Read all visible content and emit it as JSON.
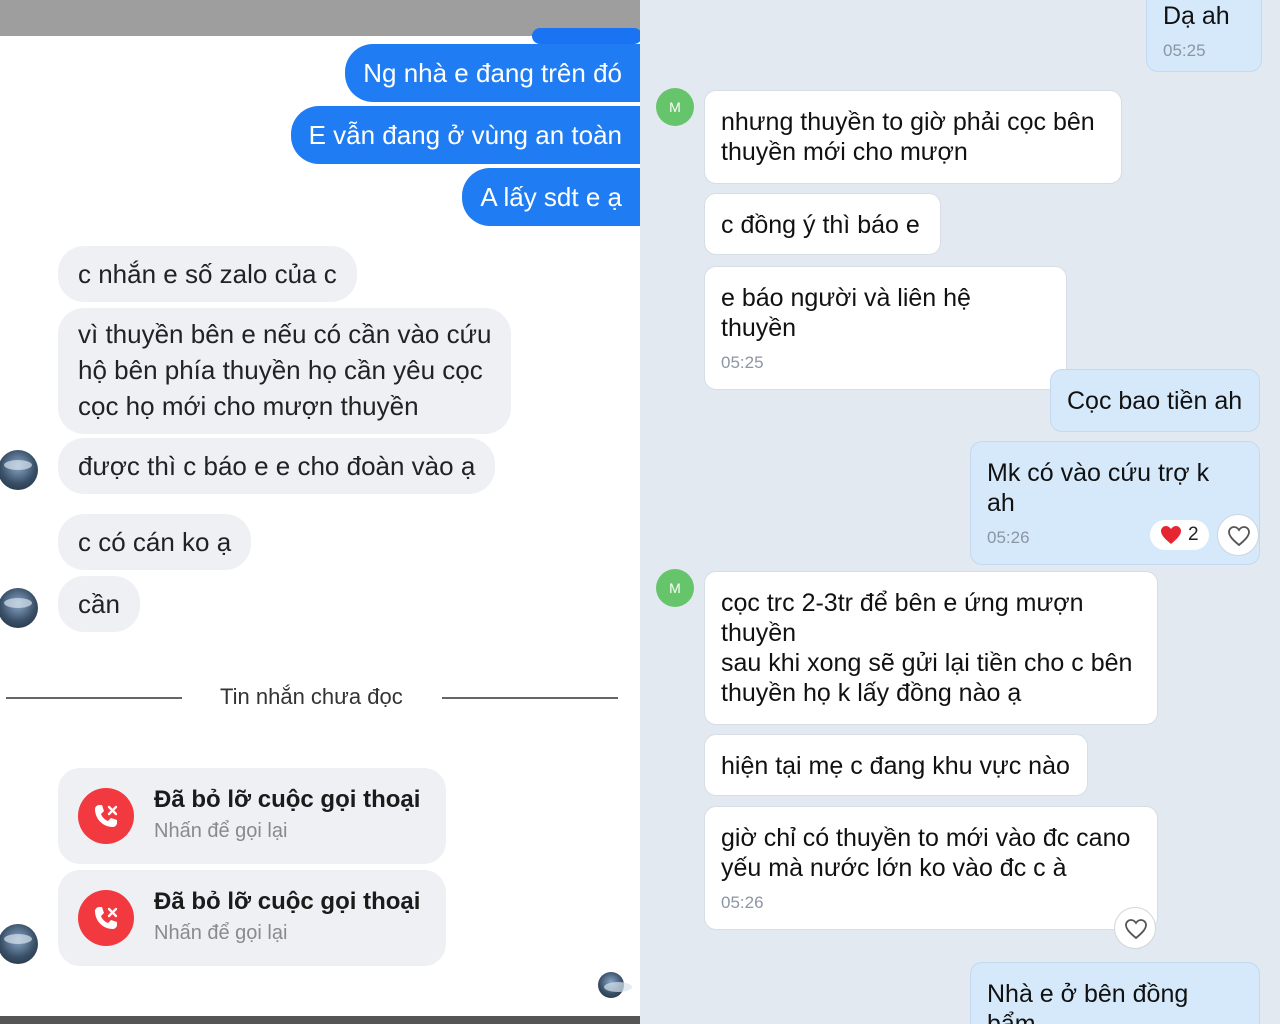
{
  "left_panel": {
    "outgoing": [
      "Ng nhà e đang trên đó",
      "E vẫn đang ở vùng an toàn",
      "A lấy sdt e ạ"
    ],
    "incoming": {
      "m1": "c nhắn e số zalo của c",
      "m2_lines": [
        "vì thuyền bên e nếu có cần vào cứu",
        "hộ bên phía thuyền họ cần yêu cọc",
        "cọc họ mới cho mượn thuyền"
      ],
      "m3": "được thì c báo e e cho đoàn vào ạ",
      "m4": "c có cán ko ạ",
      "m5": "cần"
    },
    "divider": "Tin nhắn chưa đọc",
    "calls": [
      {
        "title": "Đã bỏ lỡ cuộc gọi thoại",
        "subtitle": "Nhấn để gọi lại"
      },
      {
        "title": "Đã bỏ lỡ cuộc gọi thoại",
        "subtitle": "Nhấn để gọi lại"
      }
    ],
    "colors": {
      "outgoing_bubble": "#1f7cf2",
      "incoming_bubble": "#eef0f4",
      "missed_call": "#f2393f"
    }
  },
  "right_panel": {
    "avatar_letter": "M",
    "messages": {
      "out1": {
        "text": "Dạ ah",
        "time": "05:25"
      },
      "in1_lines": [
        "nhưng thuyền to giờ phải cọc bên",
        "thuyền mới cho mượn"
      ],
      "in2": "c đồng ý thì báo e",
      "in3": {
        "text": "e báo người và liên hệ thuyền",
        "time": "05:25"
      },
      "out2": "Cọc bao tiền ah",
      "out3": {
        "text": "Mk có vào cứu trợ k ah",
        "time": "05:26"
      },
      "reaction_count": "2",
      "in4_lines": [
        "cọc trc 2-3tr để bên e ứng mượn",
        "thuyền",
        "sau khi xong sẽ gửi lại tiền cho c bên",
        "thuyền họ k lấy đồng nào ạ"
      ],
      "in5": "hiện tại mẹ c đang khu vực nào",
      "in6": {
        "lines": [
          "giờ chỉ có thuyền to mới vào đc cano",
          "yếu mà nước lớn ko vào đc c à"
        ],
        "time": "05:26"
      },
      "out4": "Nhà e ở bên đồng bẩm"
    },
    "colors": {
      "background": "#e2e9f1",
      "outgoing_bubble": "#d5e9fb",
      "incoming_bubble": "#ffffff",
      "avatar": "#66c46a"
    }
  }
}
